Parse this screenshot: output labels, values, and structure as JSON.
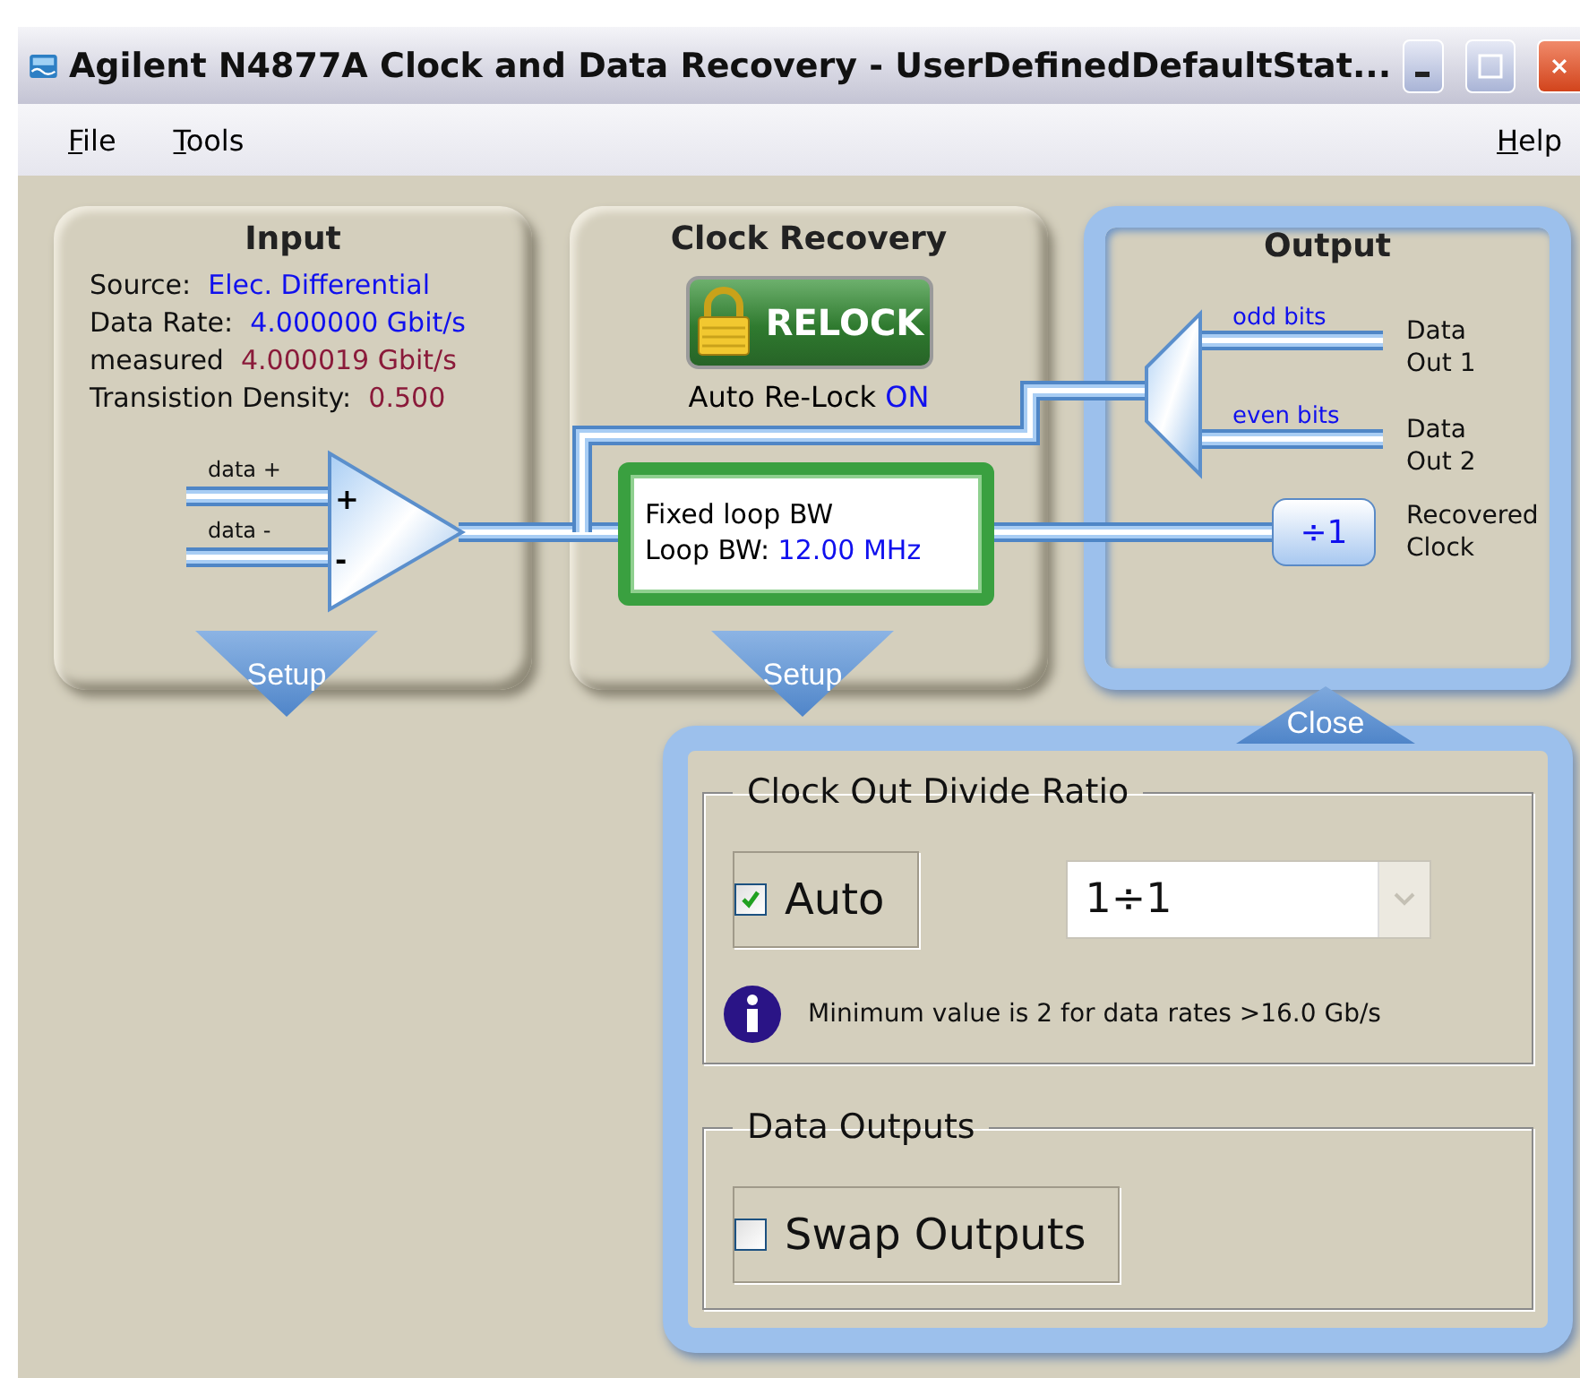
{
  "window": {
    "title": "Agilent N4877A Clock and Data Recovery - UserDefinedDefaultStat..."
  },
  "menu": {
    "left": [
      "File",
      "Tools"
    ],
    "right": [
      "Help"
    ]
  },
  "input_panel": {
    "title": "Input",
    "rows": [
      {
        "label": "Source:",
        "value": "Elec. Differential",
        "kind": "setting"
      },
      {
        "label": "Data Rate:",
        "value": "4.000000 Gbit/s",
        "kind": "setting"
      },
      {
        "label": "measured",
        "value": "4.000019 Gbit/s",
        "kind": "measured"
      },
      {
        "label": "Transistion Density:",
        "value": "0.500",
        "kind": "measured"
      }
    ],
    "inputs": [
      {
        "label": "data +",
        "sign": "+"
      },
      {
        "label": "data -",
        "sign": "-"
      }
    ],
    "setup": "Setup"
  },
  "clock_panel": {
    "title": "Clock Recovery",
    "relock": "RELOCK",
    "auto_relock": {
      "label": "Auto Re-Lock",
      "value": "ON"
    },
    "loop": {
      "mode": "Fixed loop BW",
      "label": "Loop BW:",
      "value": "12.00 MHz"
    },
    "setup": "Setup"
  },
  "output_panel": {
    "title": "Output",
    "expanded": true,
    "close": "Close",
    "lanes": [
      {
        "wire_label": "odd bits",
        "name": "Data\nOut 1"
      },
      {
        "wire_label": "even bits",
        "name": "Data\nOut 2"
      }
    ],
    "clock_output": {
      "divider": "÷1",
      "name": "Recovered\nClock"
    }
  },
  "settings_dialog": {
    "groups": [
      {
        "title": "Clock Out Divide Ratio",
        "kind": "ratio",
        "checkbox": {
          "label": "Auto",
          "checked": true
        },
        "dropdown": {
          "value": "1÷1",
          "disabled": true
        },
        "info": "Minimum value is 2 for data rates >16.0 Gb/s"
      },
      {
        "title": "Data Outputs",
        "kind": "outputs",
        "checkbox": {
          "label": "Swap Outputs",
          "checked": false
        }
      }
    ]
  }
}
